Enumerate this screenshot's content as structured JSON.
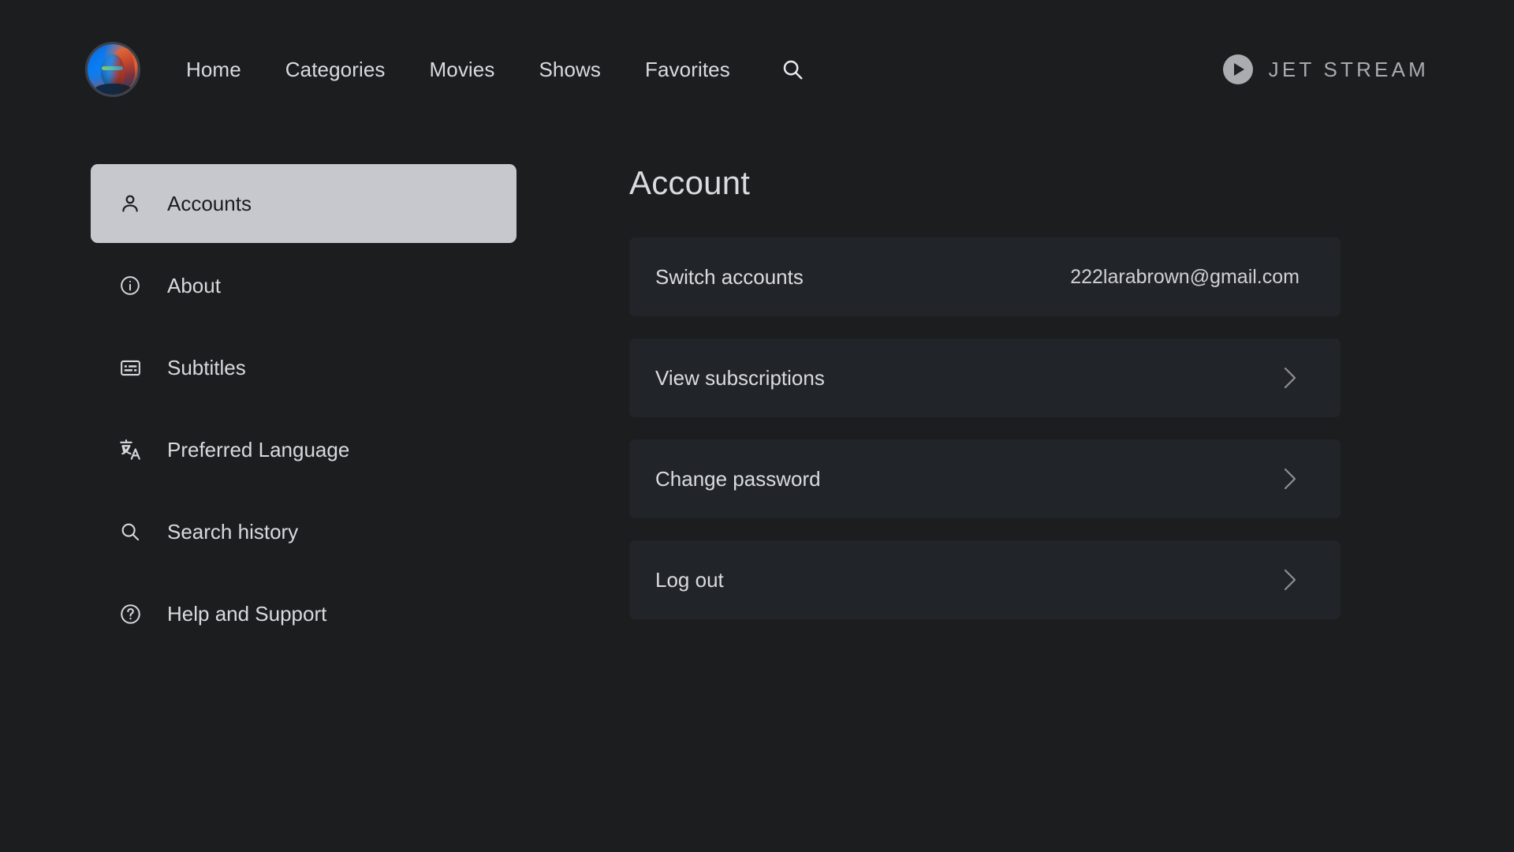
{
  "nav": {
    "avatar_alt": "user-avatar",
    "links": [
      {
        "label": "Home"
      },
      {
        "label": "Categories"
      },
      {
        "label": "Movies"
      },
      {
        "label": "Shows"
      },
      {
        "label": "Favorites"
      }
    ],
    "search_icon": "search-icon"
  },
  "brand": {
    "name": "JET STREAM",
    "icon": "play-circle-icon"
  },
  "sidebar": {
    "items": [
      {
        "label": "Accounts",
        "icon": "person-icon",
        "active": true
      },
      {
        "label": "About",
        "icon": "info-icon",
        "active": false
      },
      {
        "label": "Subtitles",
        "icon": "subtitles-icon",
        "active": false
      },
      {
        "label": "Preferred Language",
        "icon": "translate-icon",
        "active": false
      },
      {
        "label": "Search history",
        "icon": "search-icon",
        "active": false
      },
      {
        "label": "Help and Support",
        "icon": "help-icon",
        "active": false
      }
    ]
  },
  "main": {
    "title": "Account",
    "rows": [
      {
        "label": "Switch accounts",
        "value": "222larabrown@gmail.com",
        "chevron": false
      },
      {
        "label": "View subscriptions",
        "value": "",
        "chevron": true
      },
      {
        "label": "Change password",
        "value": "",
        "chevron": true
      },
      {
        "label": "Log out",
        "value": "",
        "chevron": true
      }
    ]
  },
  "colors": {
    "page_background": "#1b1d1f",
    "row_background": "#212428",
    "active_item_background": "#c7c8cd",
    "text_primary": "#d9dbde",
    "brand_text": "#a9abaf"
  }
}
